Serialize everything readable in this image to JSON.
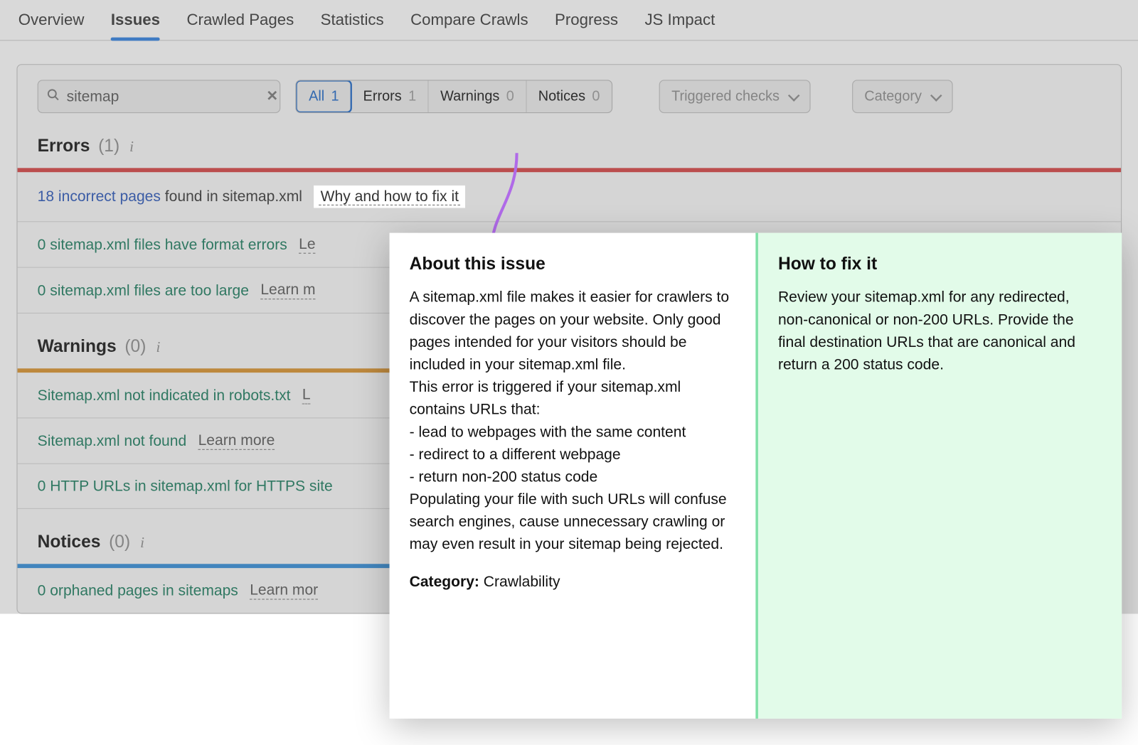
{
  "nav": {
    "tabs": [
      "Overview",
      "Issues",
      "Crawled Pages",
      "Statistics",
      "Compare Crawls",
      "Progress",
      "JS Impact"
    ],
    "active": "Issues"
  },
  "search": {
    "value": "sitemap"
  },
  "filters": {
    "segments": [
      {
        "label": "All",
        "count": "1",
        "active": true
      },
      {
        "label": "Errors",
        "count": "1"
      },
      {
        "label": "Warnings",
        "count": "0"
      },
      {
        "label": "Notices",
        "count": "0"
      }
    ],
    "triggered": "Triggered checks",
    "category": "Category"
  },
  "sections": {
    "errors": {
      "title": "Errors",
      "count": "(1)",
      "rows": [
        {
          "lead": "18 incorrect pages",
          "rest": "found in sitemap.xml",
          "action": "Why and how to fix it",
          "highlight": true
        },
        {
          "text": "0 sitemap.xml files have format errors",
          "action": "Le"
        },
        {
          "text": "0 sitemap.xml files are too large",
          "action": "Learn m"
        }
      ]
    },
    "warnings": {
      "title": "Warnings",
      "count": "(0)",
      "rows": [
        {
          "text": "Sitemap.xml not indicated in robots.txt",
          "action": "L"
        },
        {
          "text": "Sitemap.xml not found",
          "action": "Learn more"
        },
        {
          "text": "0 HTTP URLs in sitemap.xml for HTTPS site",
          "action": ""
        }
      ]
    },
    "notices": {
      "title": "Notices",
      "count": "(0)",
      "rows": [
        {
          "text": "0 orphaned pages in sitemaps",
          "action": "Learn mor"
        }
      ]
    }
  },
  "popup": {
    "about_title": "About this issue",
    "about_body": "A sitemap.xml file makes it easier for crawlers to discover the pages on your website. Only good pages intended for your visitors should be included in your sitemap.xml file.\nThis error is triggered if your sitemap.xml contains URLs that:\n- lead to webpages with the same content\n- redirect to a different webpage\n- return non-200 status code\nPopulating your file with such URLs will confuse search engines, cause unnecessary crawling or may even result in your sitemap being rejected.",
    "category_label": "Category:",
    "category_value": "Crawlability",
    "fix_title": "How to fix it",
    "fix_body": "Review your sitemap.xml for any redirected, non-canonical or non-200 URLs. Provide the final destination URLs that are canonical and return a 200 status code."
  }
}
